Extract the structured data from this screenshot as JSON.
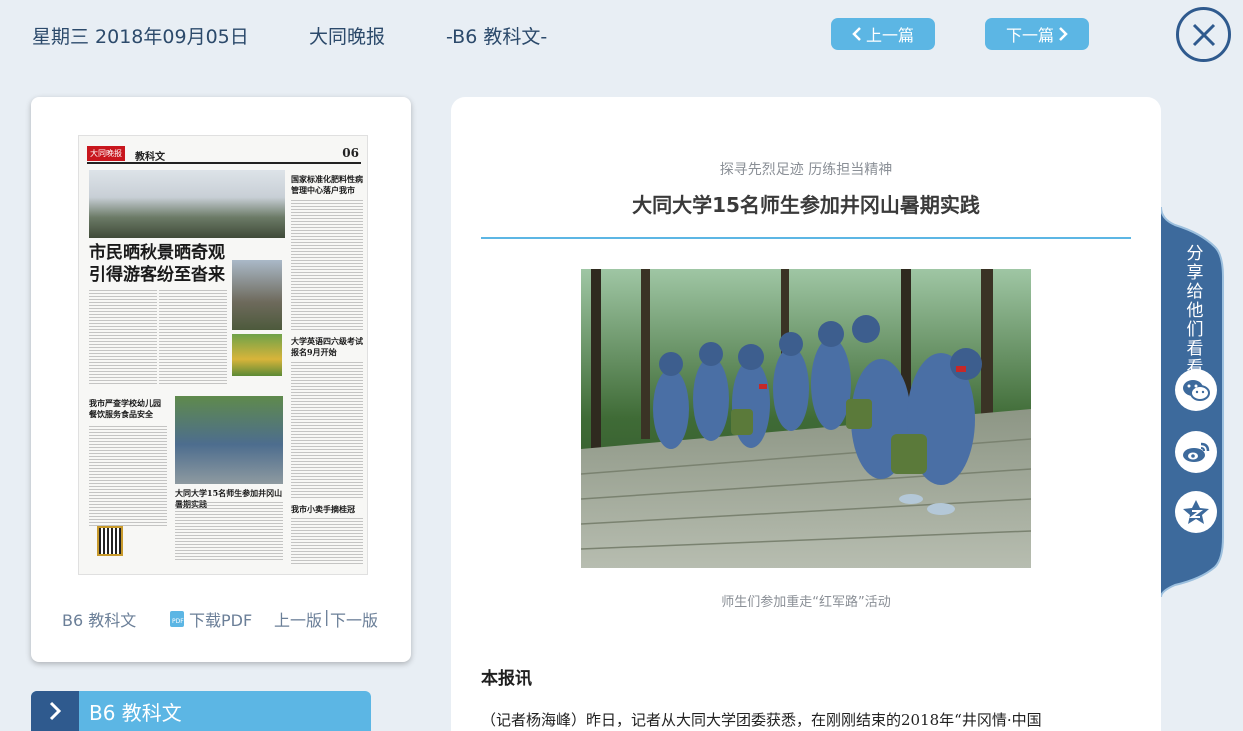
{
  "header": {
    "date": "星期三 2018年09月05日",
    "paper": "大同晚报",
    "page": "-B6 教科文-",
    "prev_label": "上一篇",
    "next_label": "下一篇"
  },
  "thumbnail": {
    "logo": "大同晚报",
    "section": "教科文",
    "page_no": "06",
    "headline_1": "市民晒秋景晒奇观",
    "headline_2": "引得游客纷至沓来",
    "sub_1": "国家标准化肥料性病管理中心落户我市",
    "sub_2": "大学英语四六级考试报名9月开始",
    "sub_3": "我市严查学校幼儿园餐饮服务食品安全",
    "sub_4": "大同大学15名师生参加井冈山暑期实践",
    "sub_5": "我市小卖手摘桂冠"
  },
  "left_links": {
    "page": "B6 教科文",
    "pdf": "下载PDF",
    "prev": "上一版",
    "sep": "|",
    "next": "下一版"
  },
  "section_bar": {
    "label": "B6 教科文"
  },
  "article": {
    "kicker": "探寻先烈足迹 历练担当精神",
    "title": "大同大学15名师生参加井冈山暑期实践",
    "caption": "师生们参加重走“红军路”活动",
    "lead": "本报讯",
    "body": "（记者杨海峰）昨日，记者从大同大学团委获悉，在刚刚结束的2018年“井冈情·中国"
  },
  "share": {
    "label": "分享给他们看看",
    "icons": [
      "wechat-icon",
      "weibo-icon",
      "qzone-icon"
    ]
  },
  "colors": {
    "accent": "#5cb6e4",
    "dark": "#2f5a8e",
    "background": "#e8eef4"
  }
}
